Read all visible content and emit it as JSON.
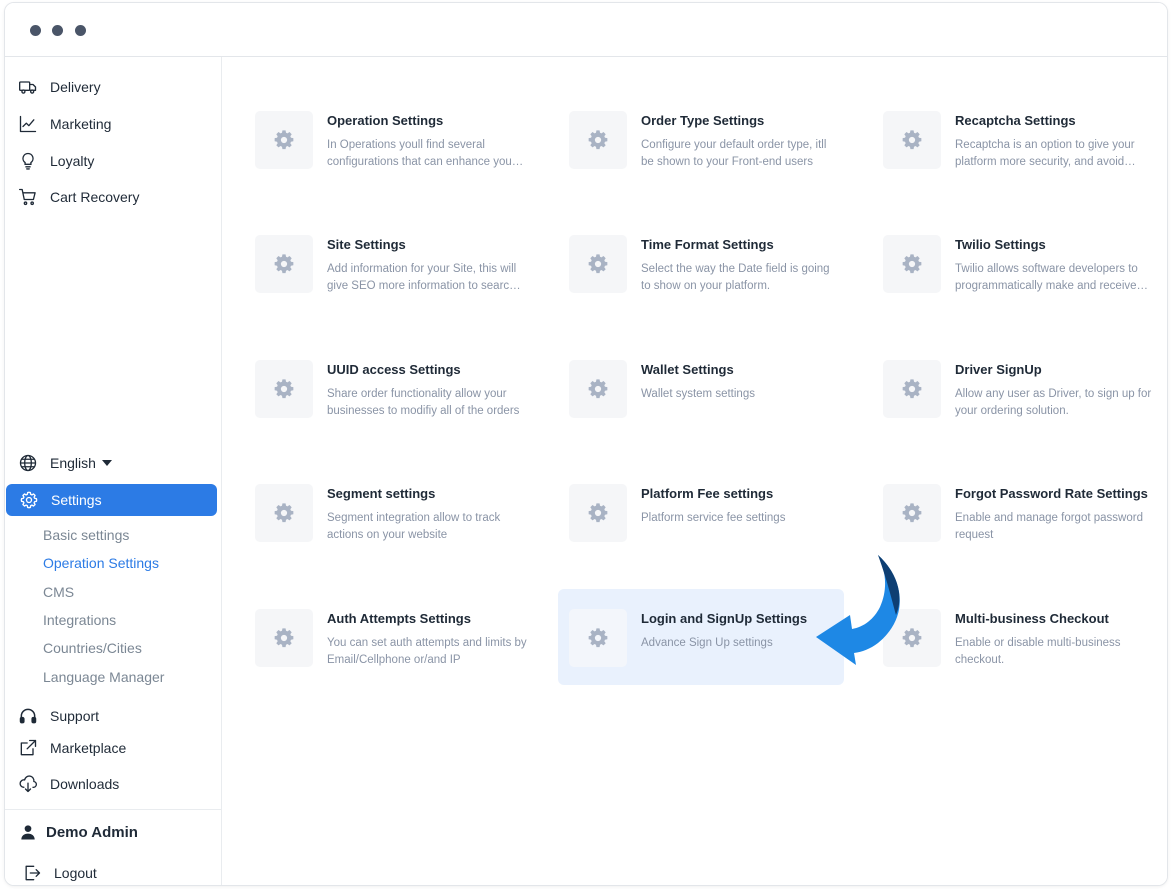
{
  "sidebar": {
    "nav_top": [
      {
        "label": "Delivery",
        "icon": "truck-icon"
      },
      {
        "label": "Marketing",
        "icon": "chart-line-icon"
      },
      {
        "label": "Loyalty",
        "icon": "lightbulb-icon"
      },
      {
        "label": "Cart Recovery",
        "icon": "cart-icon"
      }
    ],
    "language": {
      "label": "English",
      "icon": "globe-icon"
    },
    "settings": {
      "label": "Settings",
      "icon": "gear-icon"
    },
    "sub_items": [
      {
        "label": "Basic settings"
      },
      {
        "label": "Operation Settings"
      },
      {
        "label": "CMS"
      },
      {
        "label": "Integrations"
      },
      {
        "label": "Countries/Cities"
      },
      {
        "label": "Language Manager"
      }
    ],
    "nav_bottom": [
      {
        "label": "Support",
        "icon": "headset-icon"
      },
      {
        "label": "Marketplace",
        "icon": "external-link-icon"
      },
      {
        "label": "Downloads",
        "icon": "cloud-download-icon"
      }
    ],
    "user": {
      "name": "Demo Admin",
      "icon": "user-icon"
    },
    "logout": {
      "label": "Logout",
      "icon": "logout-icon"
    }
  },
  "cards": [
    {
      "title": "Operation Settings",
      "desc": "In Operations youll find several configurations that can enhance your business"
    },
    {
      "title": "Order Type Settings",
      "desc": "Configure your default order type, itll be shown to your Front-end users"
    },
    {
      "title": "Recaptcha Settings",
      "desc": "Recaptcha is an option to give your platform more security, and avoid spam"
    },
    {
      "title": "Site Settings",
      "desc": "Add information for your Site, this will give SEO more information to search engines"
    },
    {
      "title": "Time Format Settings",
      "desc": "Select the way the Date field is going to show on your platform."
    },
    {
      "title": "Twilio Settings",
      "desc": "Twilio allows software developers to programmatically make and receive calls"
    },
    {
      "title": "UUID access Settings",
      "desc": "Share order functionality allow your businesses to modifiy all of the orders"
    },
    {
      "title": "Wallet Settings",
      "desc": "Wallet system settings"
    },
    {
      "title": "Driver SignUp",
      "desc": "Allow any user as Driver, to sign up for your ordering solution."
    },
    {
      "title": "Segment settings",
      "desc": "Segment integration allow to track actions on your website"
    },
    {
      "title": "Platform Fee settings",
      "desc": "Platform service fee settings"
    },
    {
      "title": "Forgot Password Rate Settings",
      "desc": "Enable and manage forgot password request"
    },
    {
      "title": "Auth Attempts Settings",
      "desc": "You can set auth attempts and limits by Email/Cellphone or/and IP"
    },
    {
      "title": "Login and SignUp Settings",
      "desc": "Advance Sign Up settings"
    },
    {
      "title": "Multi-business Checkout",
      "desc": "Enable or disable multi-business checkout."
    }
  ],
  "colors": {
    "accent": "#2c7be5",
    "highlight": "#e9f1fd",
    "arrow": "#1e88e5"
  }
}
